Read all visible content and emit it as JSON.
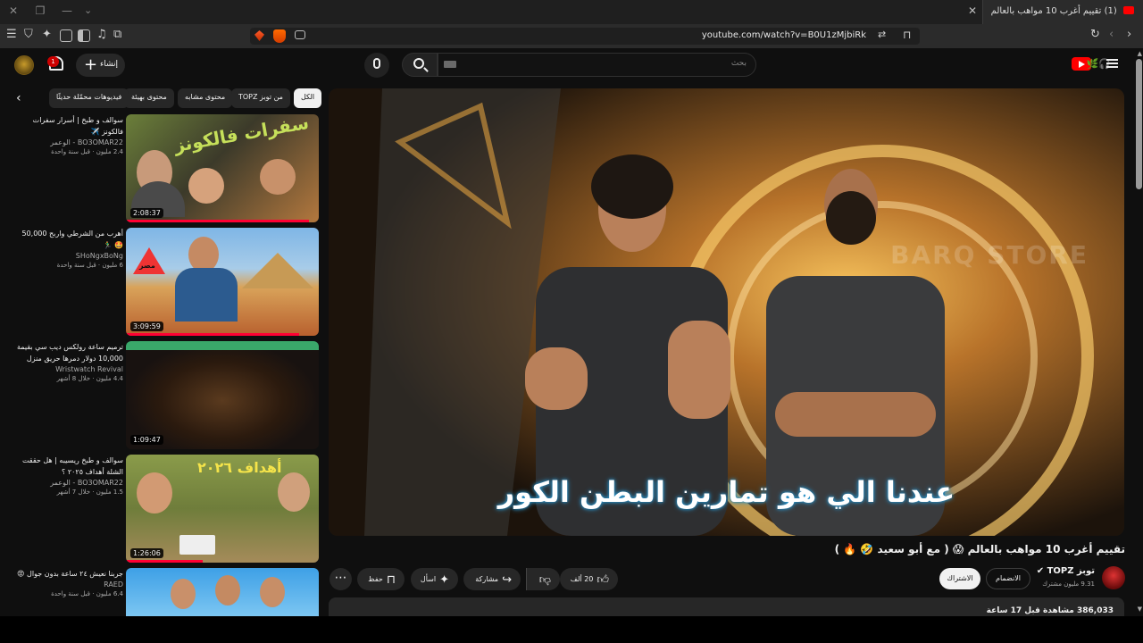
{
  "browser": {
    "tab_title": "(1) تقييم أغرب 10 مواهب بالعالم",
    "url": "youtube.com/watch?v=B0U1zMjbiRk"
  },
  "header": {
    "search_placeholder": "بحث",
    "create_label": "إنشاء",
    "notification_count": "1",
    "logo_text": "🌿🎧"
  },
  "chips": [
    {
      "label": "الكل",
      "active": true
    },
    {
      "label": "من توبز TOPZ",
      "active": false
    },
    {
      "label": "محتوى مشابه",
      "active": false
    },
    {
      "label": "محتوى بهيئة",
      "active": false
    },
    {
      "label": "فيديوهات محمّلة حديثًا",
      "active": false
    }
  ],
  "recommendations": [
    {
      "title": "سوالف و طبخ | أسرار سفرات فالكونز ✈️",
      "channel": "BO3OMAR22 - الوعمر",
      "stats": "2.4 مليون · قبل سنة واحدة",
      "duration": "2:08:37",
      "thumb_text": "سفرات فالكونز",
      "progress": 0.95
    },
    {
      "title": "أهرب من الشرطي واربح 50,000 🤩 🏃‍♂️",
      "channel": "SHoNgxBoNg",
      "stats": "6 مليون · قبل سنة واحدة",
      "duration": "3:09:59",
      "thumb_text": "مصر",
      "progress": 0.9
    },
    {
      "title": "ترميم ساعة رولكس ديب سي بقيمة 10,000 دولار دمرها حريق منزل",
      "channel": "Wristwatch Revival",
      "stats": "4.4 مليون · خلال 8 أشهر",
      "duration": "1:09:47",
      "thumb_text": "",
      "progress": 0
    },
    {
      "title": "سوالف و طبخ ريسيبه | هل حققت الشلة أهداف ٢٠٢٥ ؟",
      "channel": "BO3OMAR22 - الوعمر",
      "stats": "1.5 مليون · خلال 7 أشهر",
      "duration": "1:26:06",
      "thumb_text": "أهداف ٢٠٢٦",
      "progress": 0.4
    },
    {
      "title": "جربنا نعيش ٢٤ ساعة بدون جوال 😡",
      "channel": "RAED",
      "stats": "6.4 مليون · قبل سنة واحدة",
      "duration": "",
      "thumb_text": "",
      "progress": 0
    }
  ],
  "player": {
    "subtitle": "عندنا الي هو تمارين البطن الكور",
    "watermark": "BARQ STORE"
  },
  "video": {
    "title": "تقييم أغرب 10 مواهب بالعالم 😱 ( مع أبو سعيد 🤣 🔥 )",
    "channel_name": "توبز TOPZ",
    "subscribers": "9.31 مليون مشترك",
    "join_label": "الانضمام",
    "subscribe_label": "الاشتراك",
    "likes": "20 ألف",
    "share_label": "مشاركة",
    "ask_label": "اسأل",
    "save_label": "حفظ",
    "description_stats": "386,033 مشاهدة قبل 17 ساعة"
  },
  "colors": {
    "accent": "#ff0033",
    "bg": "#0f0f0f",
    "chip": "#272727"
  }
}
